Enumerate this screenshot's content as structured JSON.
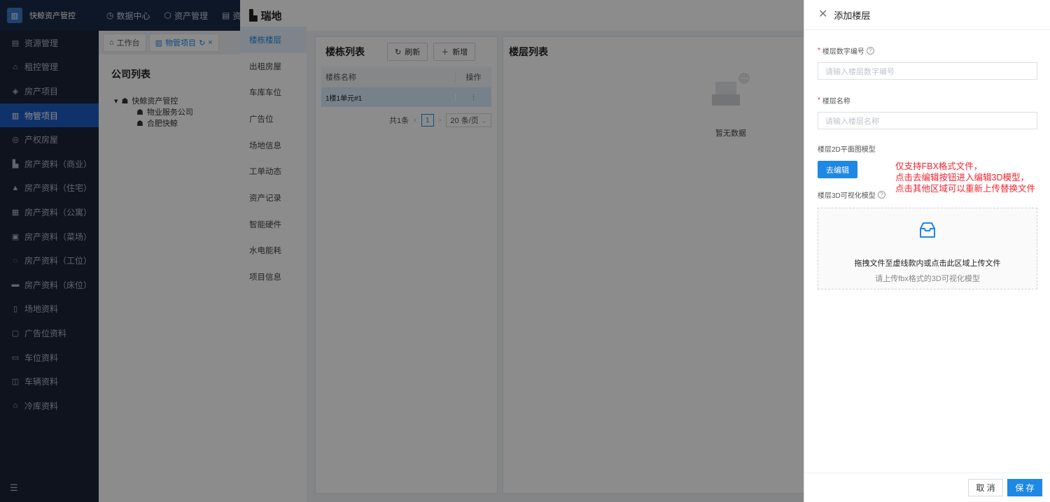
{
  "app": {
    "name": "快鲸资产管控"
  },
  "topnav": [
    "数据中心",
    "资产管理",
    "资"
  ],
  "sidebar": {
    "items": [
      {
        "label": "资源管理",
        "icon": "doc-icon"
      },
      {
        "label": "租控管理",
        "icon": "home-icon"
      },
      {
        "label": "房产项目",
        "icon": "layers-icon"
      },
      {
        "label": "物管项目",
        "icon": "building-icon",
        "active": true
      },
      {
        "label": "产权房屋",
        "icon": "stack-icon"
      },
      {
        "label": "房产资料（商业）",
        "icon": "shop-icon"
      },
      {
        "label": "房产资料（住宅）",
        "icon": "house-icon"
      },
      {
        "label": "房产资料（公寓）",
        "icon": "apartment-icon"
      },
      {
        "label": "房产资料（菜场）",
        "icon": "market-icon"
      },
      {
        "label": "房产资料（工位）",
        "icon": "desk-icon"
      },
      {
        "label": "房产资料（床位）",
        "icon": "bed-icon"
      },
      {
        "label": "场地资料",
        "icon": "venue-icon"
      },
      {
        "label": "广告位资料",
        "icon": "ad-icon"
      },
      {
        "label": "车位资料",
        "icon": "parking-icon"
      },
      {
        "label": "车辆资料",
        "icon": "car-icon"
      },
      {
        "label": "冷库资料",
        "icon": "coldstore-icon"
      }
    ]
  },
  "tabs": [
    {
      "label": "工作台"
    },
    {
      "label": "物管项目"
    }
  ],
  "company": {
    "title": "公司列表",
    "tree": [
      {
        "label": "快鲸资产管控",
        "level": 1
      },
      {
        "label": "物业服务公司",
        "level": 2
      },
      {
        "label": "合肥快鲸",
        "level": 2
      }
    ]
  },
  "page": {
    "title": "瑞地"
  },
  "subnav": [
    "楼栋楼层",
    "出租房屋",
    "车库车位",
    "广告位",
    "场地信息",
    "工单动态",
    "资产记录",
    "智能硬件",
    "水电能耗",
    "项目信息"
  ],
  "building_panel": {
    "title": "楼栋列表",
    "refresh_label": "刷新",
    "add_label": "新增",
    "col_name": "楼栋名称",
    "col_action": "操作",
    "rows": [
      {
        "name": "1楼1单元#1",
        "action": "⋮"
      }
    ],
    "total": "共1条",
    "page": "1",
    "page_size": "20 条/页"
  },
  "floor_panel": {
    "title": "楼层列表",
    "empty_text": "暂无数据"
  },
  "drawer": {
    "title": "添加楼层",
    "field_number_label": "楼层数字编号",
    "field_number_placeholder": "请输入楼层数字编号",
    "field_name_label": "楼层名称",
    "field_name_placeholder": "请输入楼层名称",
    "model2d_label": "楼层2D平面图模型",
    "edit_button": "去编辑",
    "model3d_label": "楼层3D可视化模型",
    "upload_main": "拖拽文件至虚线款内或点击此区域上传文件",
    "upload_sub": "请上传fbx格式的3D可视化模型",
    "note_lines": [
      "仅支持FBX格式文件，",
      "点击去编辑按钮进入编辑3D模型，",
      "点击其他区域可以重新上传替换文件"
    ],
    "cancel": "取 消",
    "save": "保 存"
  },
  "colors": {
    "primary": "#1e88e5",
    "sidebar_bg": "#1b2436",
    "topbar_bg": "#1a2a4a",
    "danger": "#f5222d"
  }
}
